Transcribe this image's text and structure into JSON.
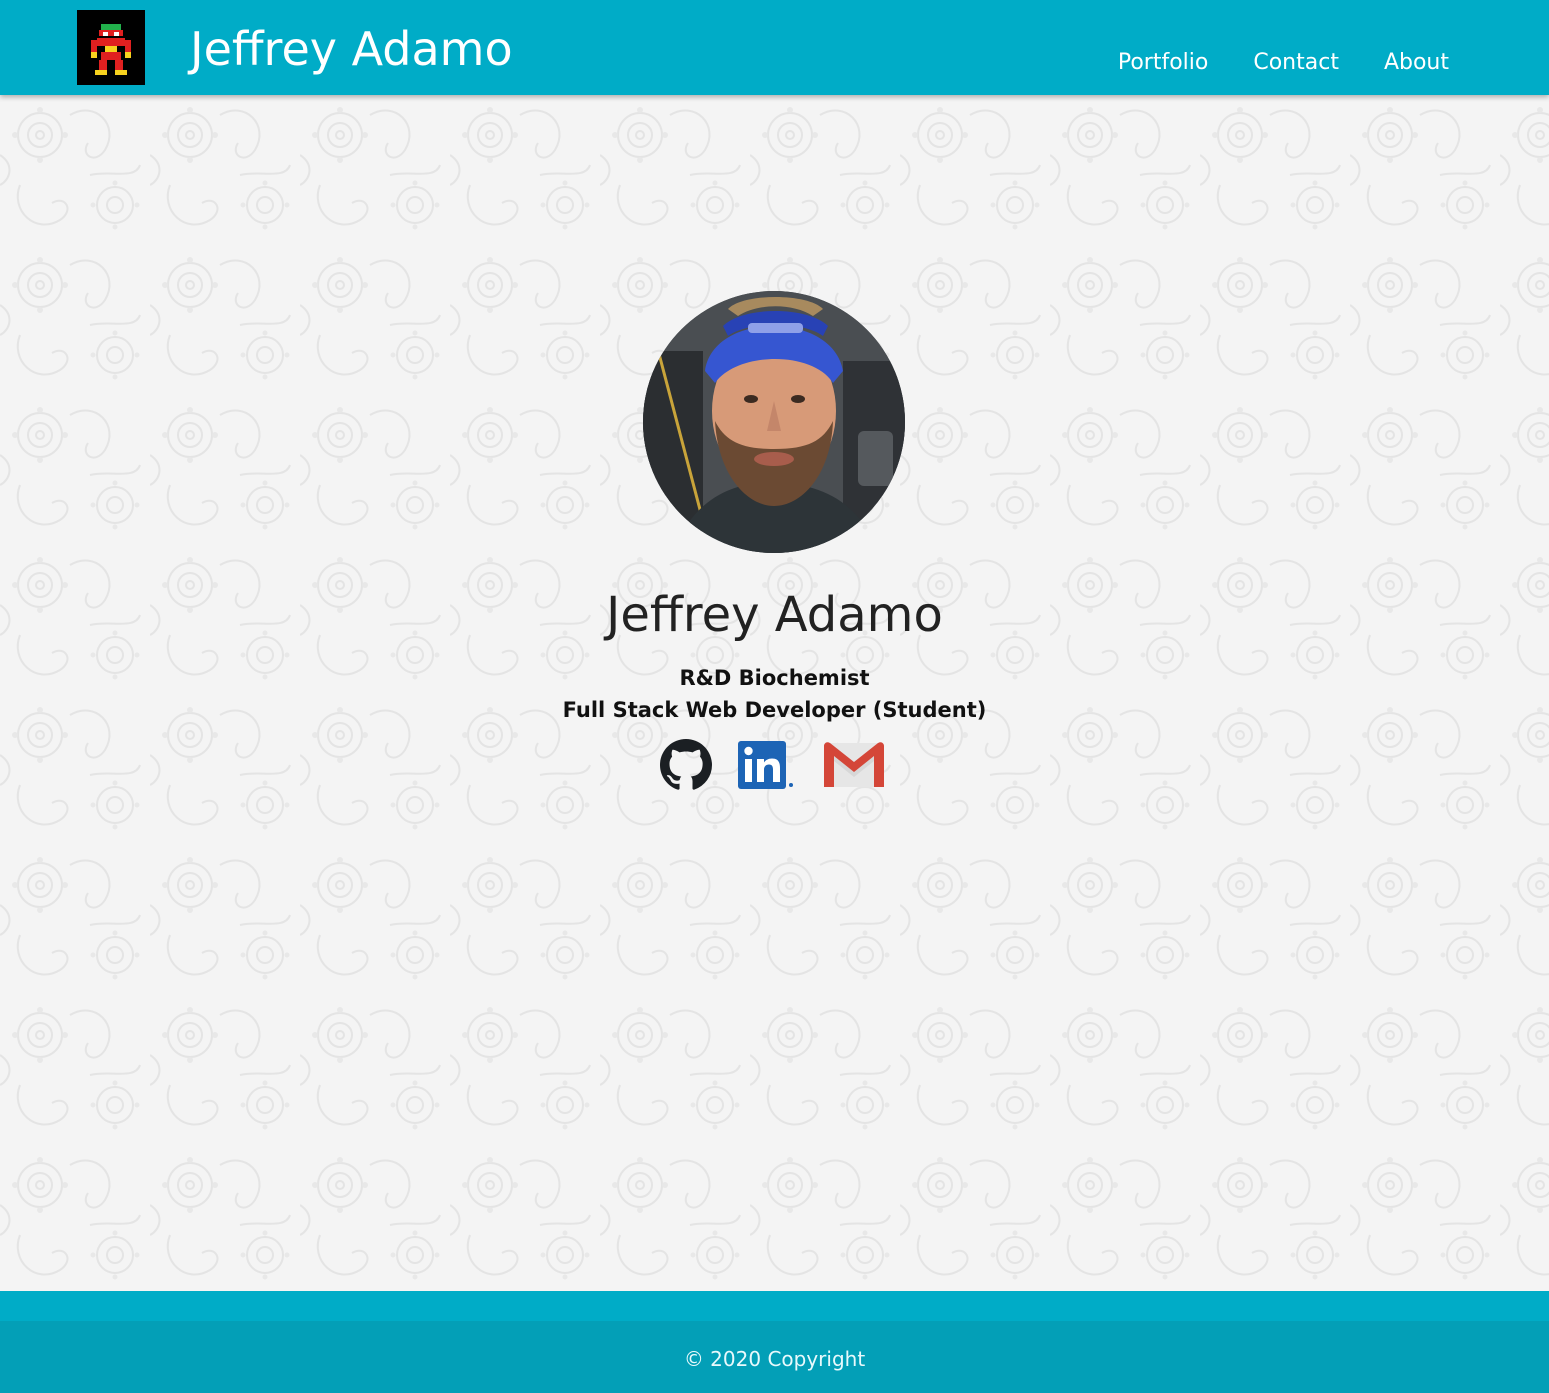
{
  "header": {
    "brand": "Jeffrey Adamo",
    "logo_icon": "pixel-robot-icon",
    "nav": [
      {
        "label": "Portfolio"
      },
      {
        "label": "Contact"
      },
      {
        "label": "About"
      }
    ]
  },
  "profile": {
    "name": "Jeffrey Adamo",
    "title1": "R&D Biochemist",
    "title2": "Full Stack Web Developer (Student)",
    "socials": [
      {
        "icon": "github-icon"
      },
      {
        "icon": "linkedin-icon"
      },
      {
        "icon": "gmail-icon"
      }
    ]
  },
  "footer": {
    "copyright": "© 2020 Copyright"
  },
  "colors": {
    "accent": "#00acc7",
    "footer": "#039fb7",
    "background": "#f2f2f2",
    "linkedin": "#1d64b5",
    "gmail_red": "#d44638"
  }
}
